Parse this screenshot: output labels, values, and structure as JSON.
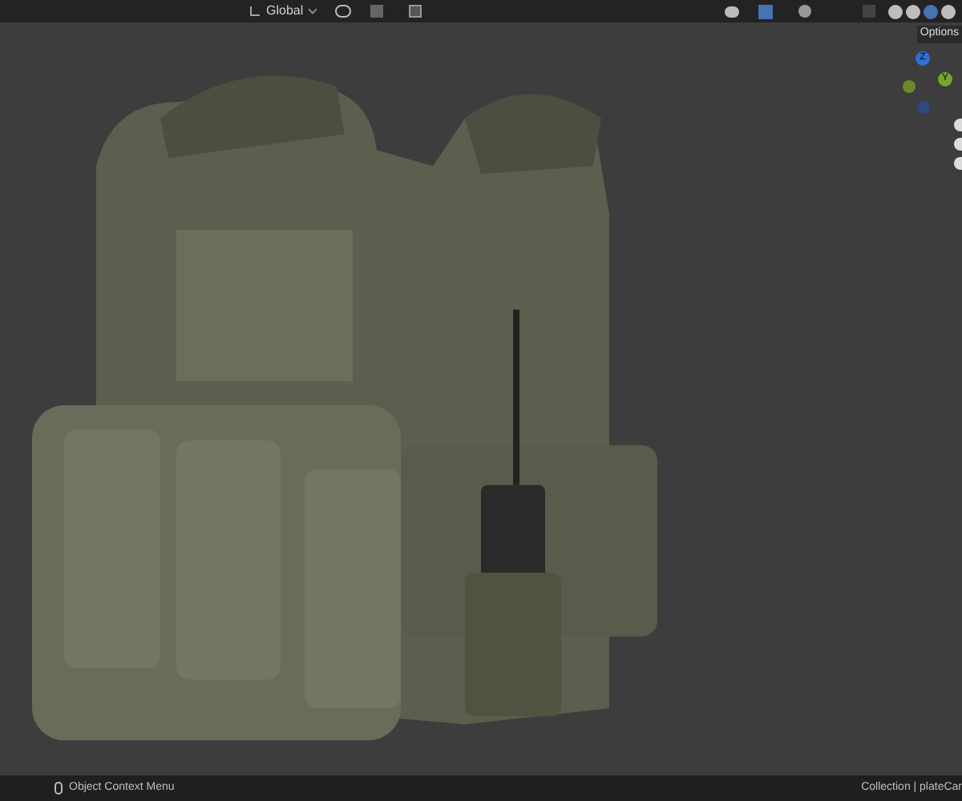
{
  "header": {
    "orientation": "Global",
    "shading_modes": [
      {
        "selected": false
      },
      {
        "selected": false
      },
      {
        "selected": true
      },
      {
        "selected": false
      }
    ]
  },
  "viewport": {
    "kind": "picture",
    "options_label": "Options",
    "gizmo_axes": [
      {
        "label": "Z",
        "color": "#2f6fd8"
      },
      {
        "label": "Y",
        "color": "#7aa32c"
      }
    ]
  },
  "status_bar": {
    "hint": "Object Context Menu",
    "info": "Collection | plateCar"
  }
}
